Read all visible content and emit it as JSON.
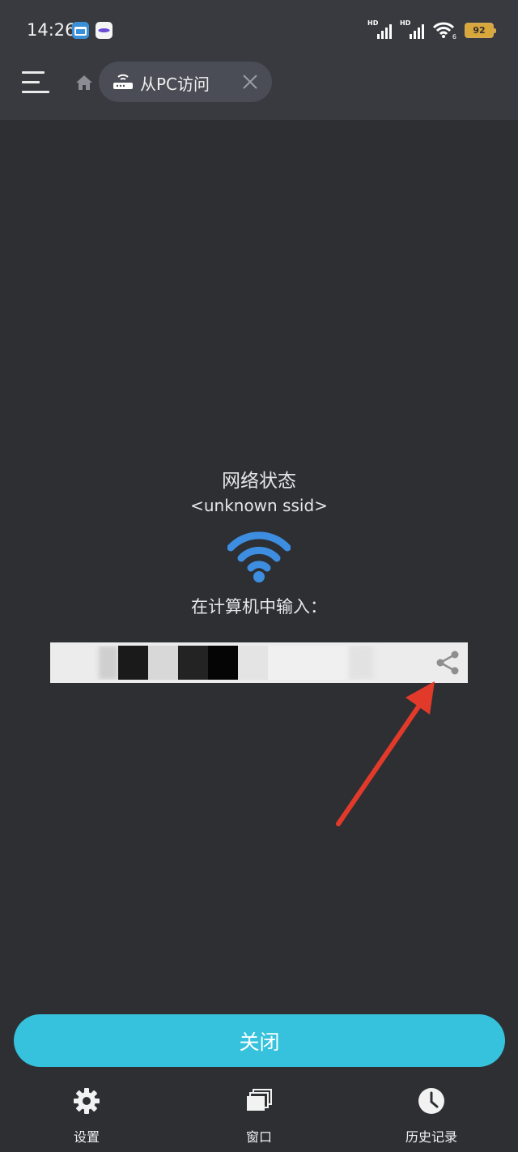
{
  "status_bar": {
    "time": "14:26",
    "network_label_1": "HD",
    "network_label_2": "HD",
    "wifi_label": "6",
    "battery": "92"
  },
  "toolbar": {
    "tab_label": "从PC访问",
    "icons": [
      "menu-icon",
      "home-icon",
      "router-icon",
      "close-icon"
    ]
  },
  "main": {
    "network_title": "网络状态",
    "ssid": "<unknown ssid>",
    "instruction": "在计算机中输入："
  },
  "actions": {
    "close_label": "关闭"
  },
  "bottom_nav": {
    "items": [
      {
        "label": "设置",
        "icon": "gear-icon"
      },
      {
        "label": "窗口",
        "icon": "windows-icon"
      },
      {
        "label": "历史记录",
        "icon": "clock-icon"
      }
    ]
  },
  "colors": {
    "background": "#2d2f33",
    "bar": "#383a40",
    "accent": "#36c2dc",
    "wifi": "#3d8ee0",
    "arrow": "#e23a2a",
    "battery": "#d9a63a"
  }
}
